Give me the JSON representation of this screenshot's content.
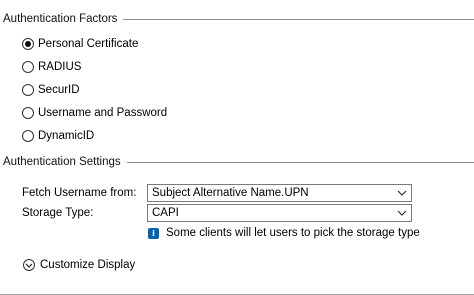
{
  "auth_factors": {
    "title": "Authentication Factors",
    "options": [
      {
        "label": "Personal Certificate",
        "selected": true
      },
      {
        "label": "RADIUS",
        "selected": false
      },
      {
        "label": "SecurID",
        "selected": false
      },
      {
        "label": "Username and Password",
        "selected": false
      },
      {
        "label": "DynamicID",
        "selected": false
      }
    ]
  },
  "auth_settings": {
    "title": "Authentication Settings",
    "fetch_username_label": "Fetch Username from:",
    "fetch_username_value": "Subject Alternative Name.UPN",
    "storage_type_label": "Storage Type:",
    "storage_type_value": "CAPI",
    "info_icon": "info-icon",
    "info_text": "Some clients will let users to pick the storage type"
  },
  "customize": {
    "label": "Customize Display",
    "icon": "chevron-down-icon"
  },
  "colors": {
    "info_icon_bg": "#0063b1",
    "divider": "#8f8f8f",
    "select_border": "#7a7a7a"
  }
}
